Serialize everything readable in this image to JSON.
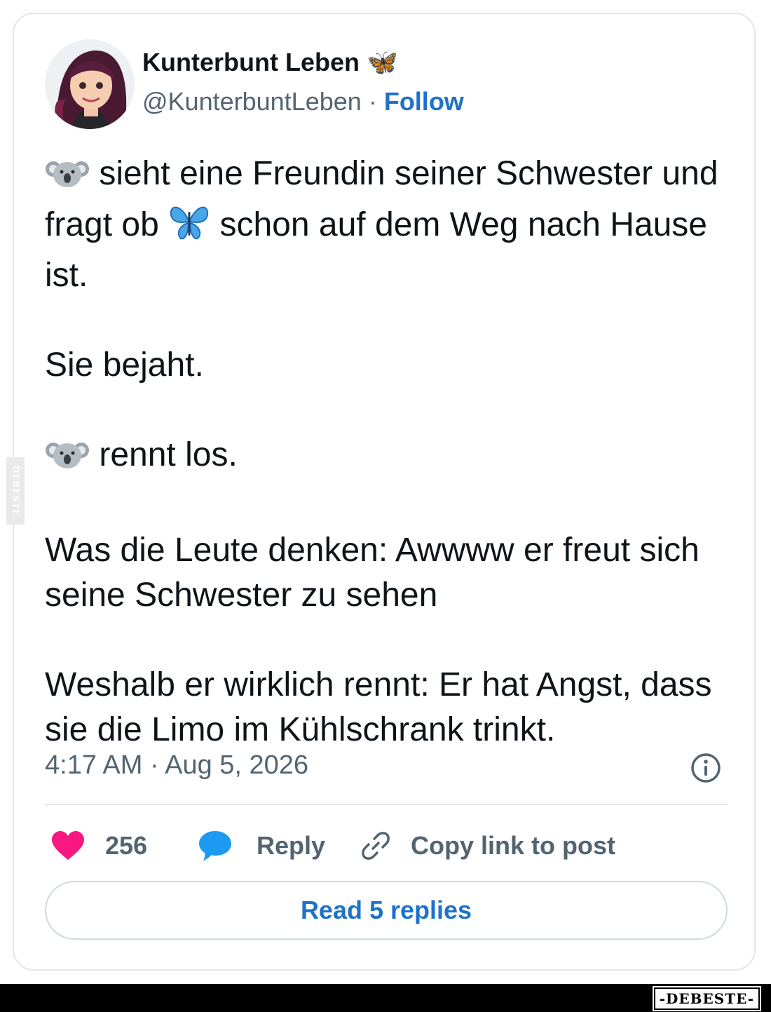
{
  "tweet": {
    "author_name": "Kunterbunt Leben 🦋",
    "handle": "@KunterbuntLeben",
    "separator": "·",
    "follow_label": "Follow",
    "paragraphs": {
      "p1_a": "sieht eine Freundin seiner Schwester und fragt ob",
      "p1_b": "schon auf dem Weg nach Hause ist.",
      "p2": "Sie bejaht.",
      "p3": "rennt los.",
      "p4": "Was die Leute denken: Awwww er freut sich seine Schwester zu sehen",
      "p5": "Weshalb er wirklich rennt: Er hat Angst, dass sie die Limo im Kühlschrank trinkt."
    },
    "emojis": [
      "koala",
      "butterfly"
    ],
    "timestamp": "4:17 AM · Aug 5, 2026"
  },
  "actions": {
    "like_count": "256",
    "reply_label": "Reply",
    "copy_label": "Copy link to post",
    "read_replies_label": "Read 5 replies"
  },
  "watermark": {
    "side_text": "DEBESTE",
    "footer_text": "-DEBESTE-"
  },
  "colors": {
    "link_blue": "#1d72c9",
    "heart_pink": "#f91880",
    "reply_blue": "#1d9bf0",
    "muted_gray": "#536471",
    "border": "#e3e6e9"
  }
}
